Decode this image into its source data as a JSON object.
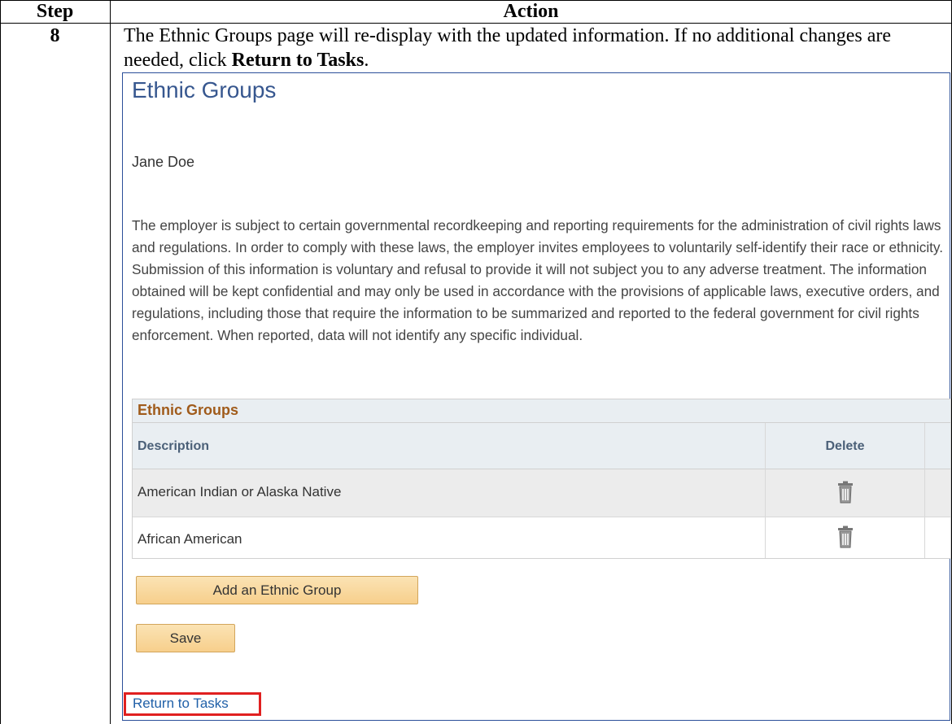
{
  "table": {
    "header_step": "Step",
    "header_action": "Action",
    "step_number": "8",
    "instruction_part1": "The Ethnic Groups page will re-display with the updated information. If no additional changes are needed, click ",
    "instruction_bold": "Return to Tasks",
    "instruction_part2": "."
  },
  "screen": {
    "page_title": "Ethnic Groups",
    "person_name": "Jane Doe",
    "paragraph": "The employer is subject to certain governmental recordkeeping and reporting requirements for the administration of civil rights laws and regulations. In order to comply with these laws, the employer invites employees to voluntarily self-identify their race or ethnicity. Submission of this information is voluntary and refusal to provide it will not subject you to any adverse treatment. The information obtained will be kept confidential and may only be used in accordance with the provisions of applicable laws, executive orders, and regulations, including those that require the information to be summarized and reported to the federal government for civil rights enforcement. When reported, data will not identify any specific individual.",
    "grid": {
      "title": "Ethnic Groups",
      "col_description": "Description",
      "col_delete": "Delete",
      "rows": [
        {
          "description": "American Indian or Alaska Native"
        },
        {
          "description": "African American"
        }
      ]
    },
    "add_button": "Add an Ethnic Group",
    "save_button": "Save",
    "return_link": "Return to Tasks"
  },
  "colors": {
    "title_blue": "#37578f",
    "grid_title_orange": "#a05b1b",
    "button_fill": "#f7cf8c",
    "highlight_red": "#e02020",
    "link_blue": "#2060a8"
  },
  "icons": [
    "trash-icon"
  ]
}
